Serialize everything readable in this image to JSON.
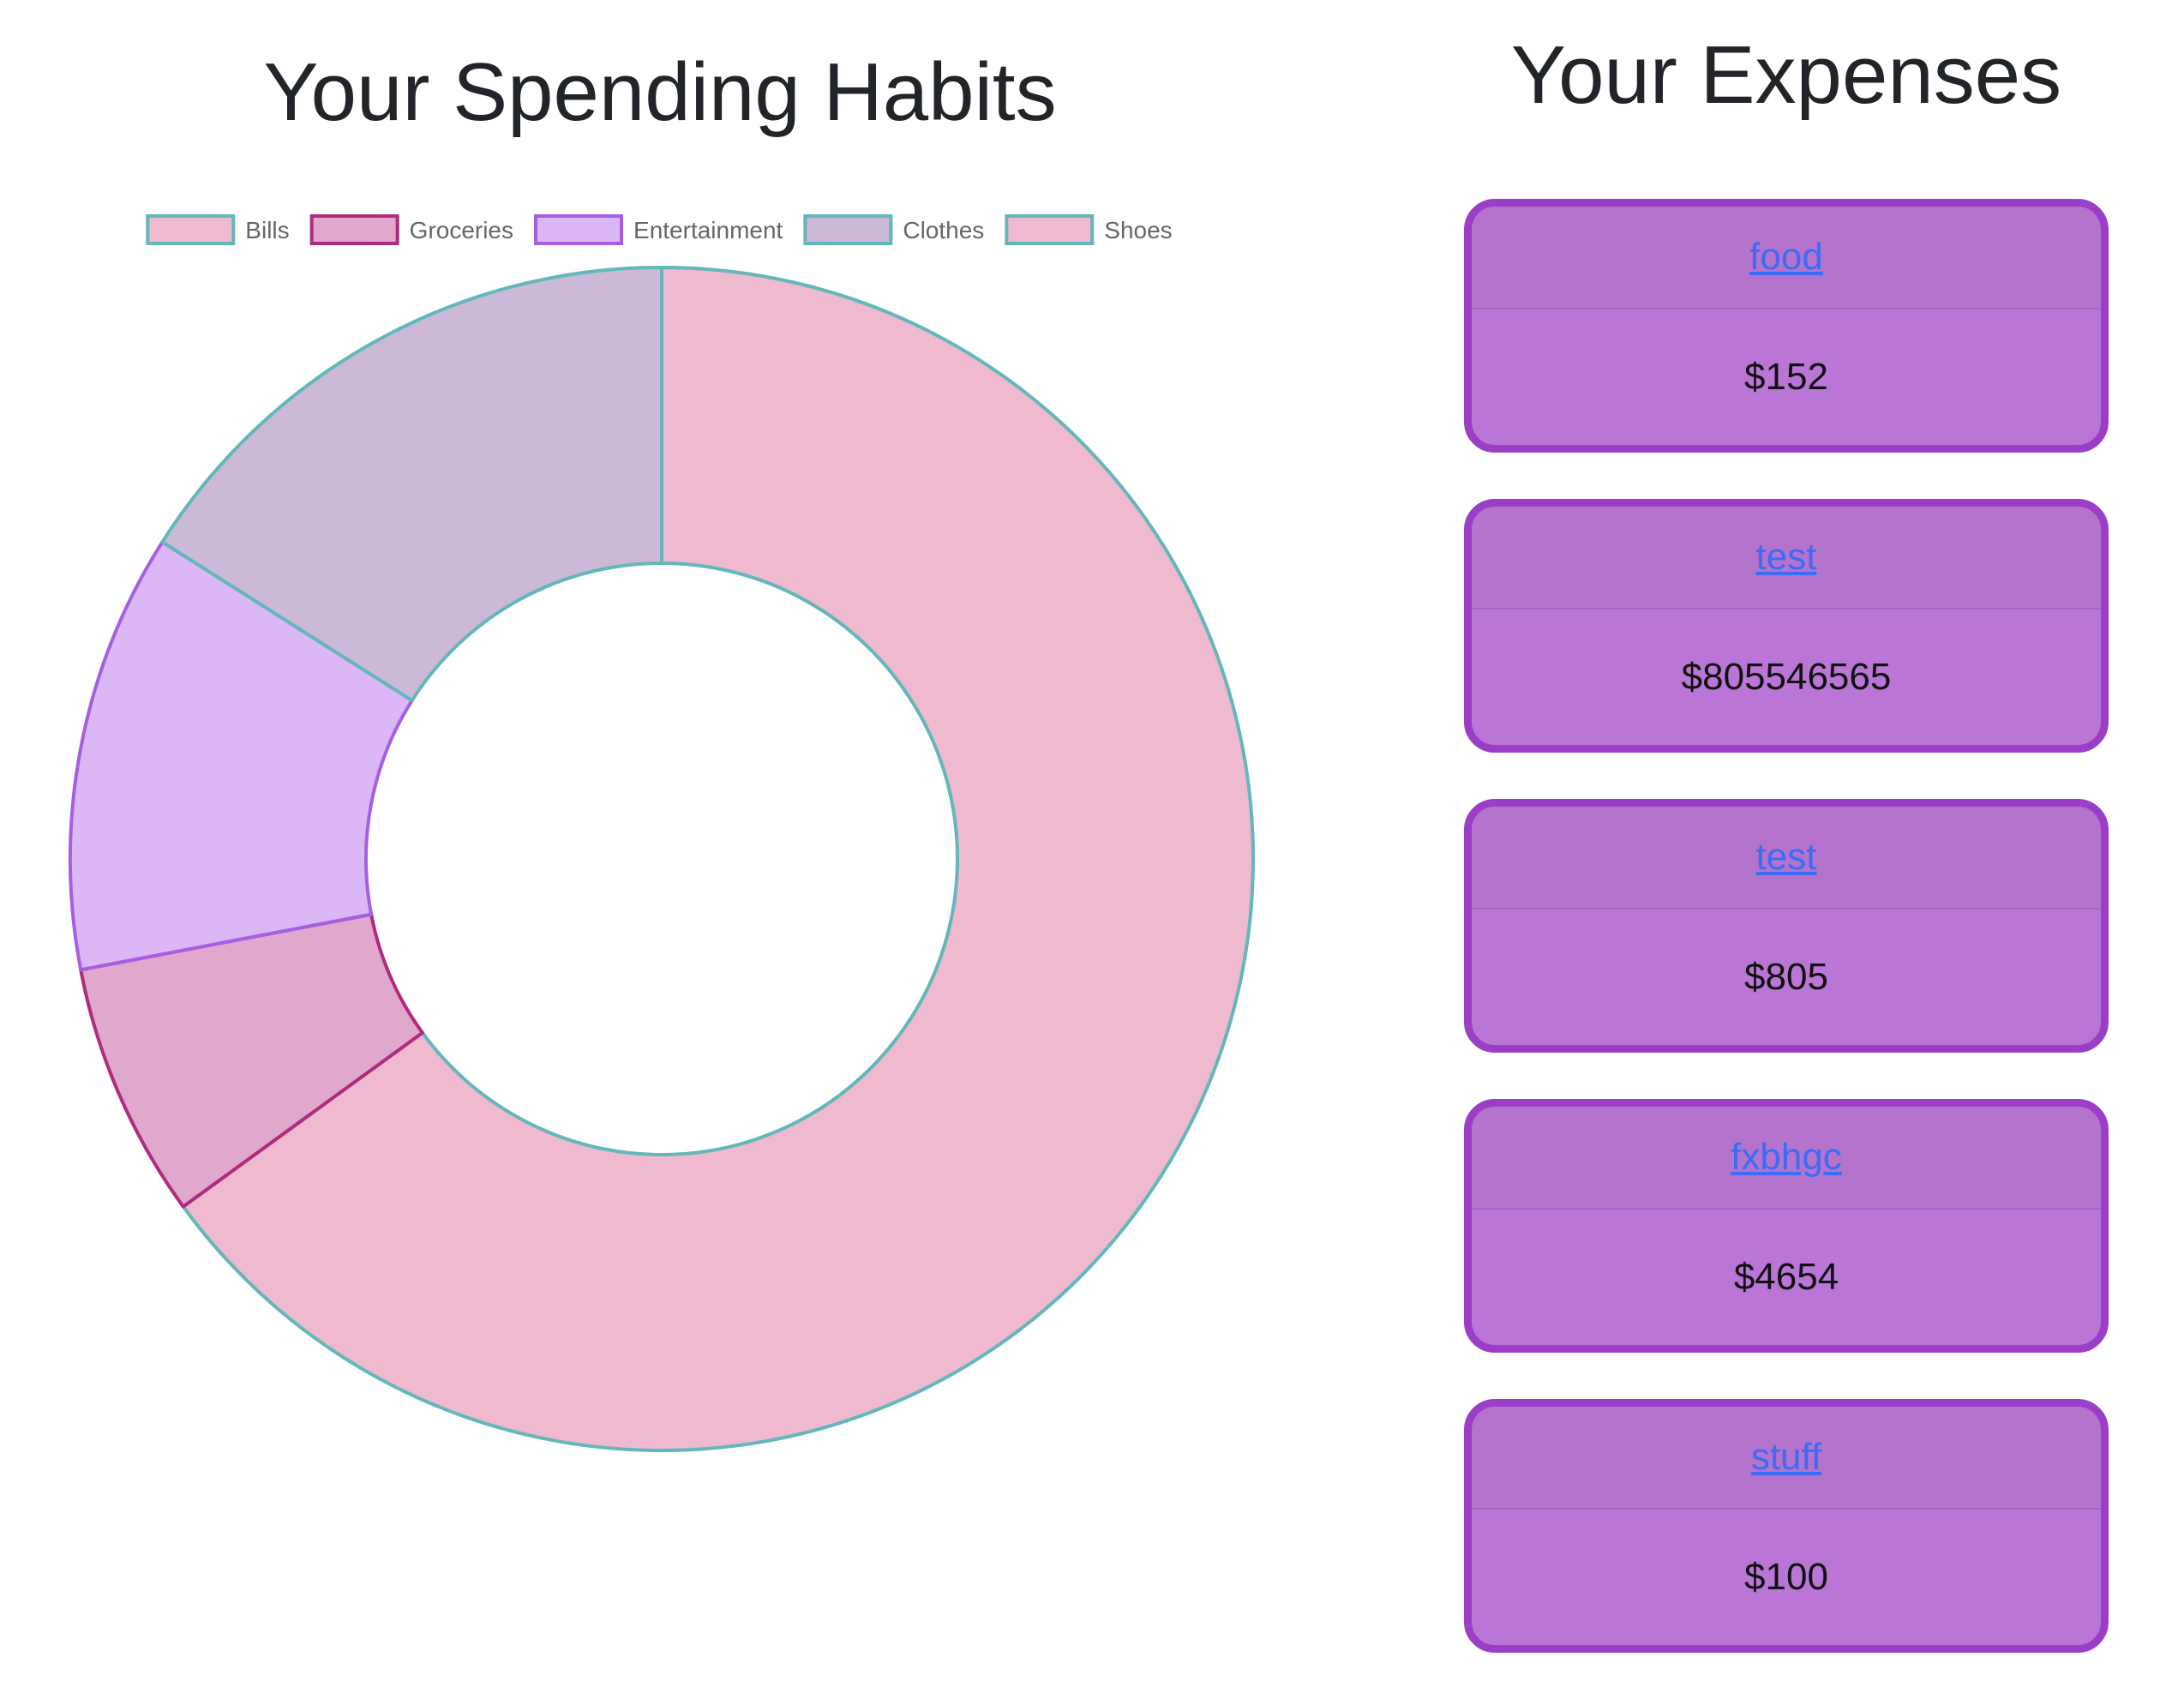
{
  "chart_panel": {
    "title": "Your Spending Habits"
  },
  "chart_data": {
    "type": "pie",
    "variant": "doughnut",
    "categories": [
      "Bills",
      "Groceries",
      "Entertainment",
      "Clothes",
      "Shoes"
    ],
    "values": [
      65,
      7,
      12,
      16,
      0
    ],
    "colors": {
      "fills": [
        "#efb9cf",
        "#e0a8cd",
        "#dbb8f5",
        "#ccb9d8",
        "#efb9cf"
      ],
      "borders": [
        "#62b7ba",
        "#b02a7f",
        "#a65ee3",
        "#62b7ba",
        "#62b7ba"
      ]
    },
    "legend_position": "top"
  },
  "expenses_panel": {
    "title": "Your Expenses",
    "items": [
      {
        "name": "food",
        "amount": "$152"
      },
      {
        "name": "test",
        "amount": "$805546565"
      },
      {
        "name": "test",
        "amount": "$805"
      },
      {
        "name": "fxbhgc",
        "amount": "$4654"
      },
      {
        "name": "stuff",
        "amount": "$100"
      }
    ]
  },
  "colors": {
    "card_border": "#9a3ec7",
    "card_fill": "#ba76d6",
    "card_header_fill": "#b473cd",
    "link": "#3a6cf5"
  }
}
